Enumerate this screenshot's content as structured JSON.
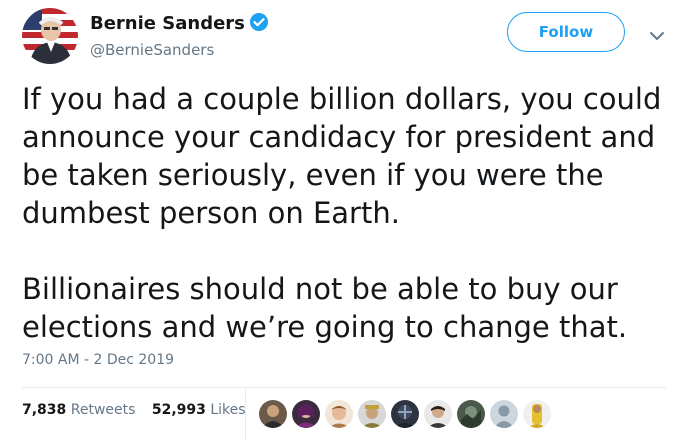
{
  "user": {
    "name": "Bernie Sanders",
    "handle": "@BernieSanders",
    "verified": true
  },
  "follow_button": {
    "label": "Follow"
  },
  "tweet": {
    "paragraph1": "If you had a couple billion dollars, you could announce your candidacy for president and be taken seriously, even if you were the dumbest person on Earth.",
    "paragraph2": "Billionaires should not be able to buy our elections and we’re going to change that."
  },
  "timestamp": "7:00 AM - 2 Dec 2019",
  "stats": {
    "retweets_count": "7,838",
    "retweets_label": "Retweets",
    "likes_count": "52,993",
    "likes_label": "Likes"
  },
  "icons": {
    "verified": "verified-badge-icon",
    "caret": "chevron-down-icon"
  },
  "colors": {
    "accent": "#1da1f2",
    "text": "#14171a",
    "muted": "#657786",
    "divider": "#e6ecf0"
  }
}
